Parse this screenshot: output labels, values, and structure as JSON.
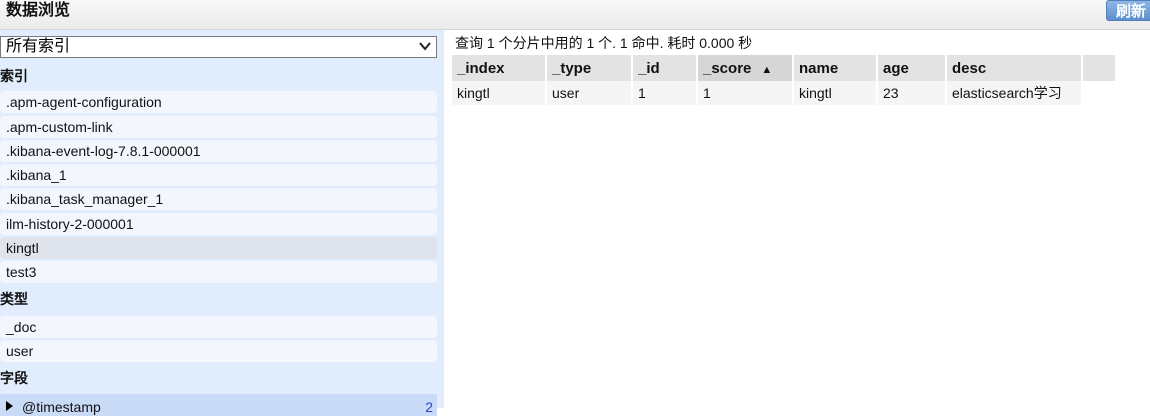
{
  "header": {
    "title": "数据浏览",
    "refresh_label": "刷新"
  },
  "sidebar": {
    "index_select_value": "所有索引",
    "index_section_label": "索引",
    "indices": [
      ".apm-agent-configuration",
      ".apm-custom-link",
      ".kibana-event-log-7.8.1-000001",
      ".kibana_1",
      ".kibana_task_manager_1",
      "ilm-history-2-000001",
      "kingtl",
      "test3"
    ],
    "selected_index": "kingtl",
    "type_section_label": "类型",
    "types": [
      "_doc",
      "user"
    ],
    "field_section_label": "字段",
    "fields": [
      {
        "label": "@timestamp",
        "count": "2"
      }
    ]
  },
  "results": {
    "summary": "查询 1 个分片中用的 1 个. 1 命中. 耗时 0.000 秒",
    "columns": [
      "_index",
      "_type",
      "_id",
      "_score",
      "name",
      "age",
      "desc"
    ],
    "sorted_column": "_score",
    "sort_arrow": "▲",
    "rows": [
      [
        "kingtl",
        "user",
        "1",
        "1",
        "kingtl",
        "23",
        "elasticsearch学习"
      ]
    ]
  }
}
